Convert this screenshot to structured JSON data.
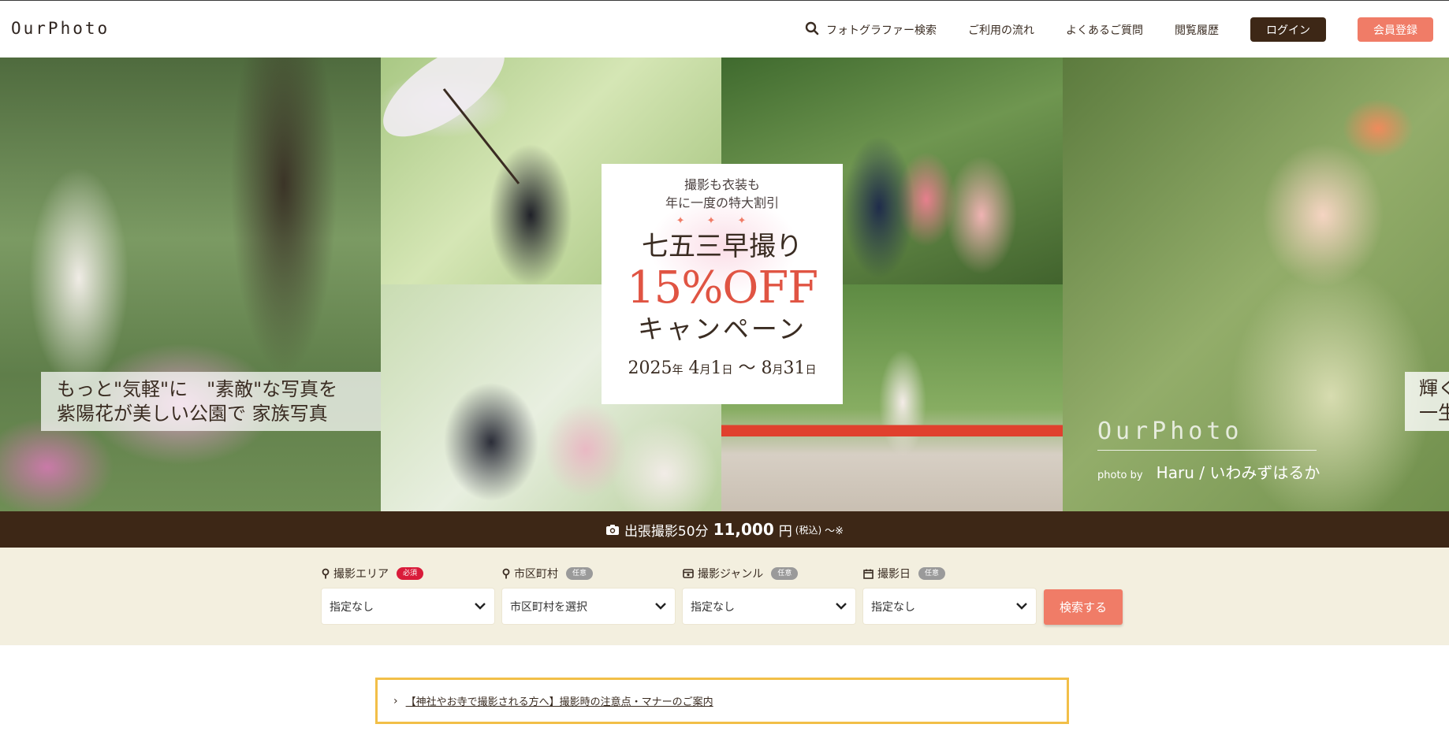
{
  "header": {
    "logo": "OurPhoto",
    "nav": [
      {
        "label": "フォトグラファー検索",
        "icon": "search-icon"
      },
      {
        "label": "ご利用の流れ"
      },
      {
        "label": "よくあるご質問"
      },
      {
        "label": "閲覧履歴"
      }
    ],
    "login_label": "ログイン",
    "register_label": "会員登録",
    "login_color": "#3d2716",
    "register_color": "#f07c67"
  },
  "hero": {
    "left_caption": {
      "line1": "もっと\"気軽\"に　\"素敵\"な写真を",
      "line2": "紫陽花が美しい公園で 家族写真"
    },
    "promo": {
      "sub1": "撮影も衣装も",
      "sub2": "年に一度の特大割引",
      "stars": "✦✦✦",
      "main": "七五三早撮り",
      "off": "15%OFF",
      "campaign": "キャンペーン",
      "date_year": "2025",
      "date_year_unit": "年",
      "date_start_month": "4",
      "date_month_unit": "月",
      "date_start_day": "1",
      "date_day_unit": "日",
      "date_sep": "～",
      "date_end_month": "8",
      "date_end_day": "31"
    },
    "brand_overlay": {
      "logo": "OurPhoto",
      "photo_by": "photo by",
      "photographer": "Haru / いわみずはるか"
    },
    "side_caption": {
      "line1": "輝く",
      "line2": "一生"
    }
  },
  "price_bar": {
    "icon": "camera-icon",
    "label": "出張撮影50分",
    "amount": "11,000",
    "unit": "円",
    "tax": "(税込)",
    "suffix": "～※",
    "bg_color": "#3d2716"
  },
  "search": {
    "fields": [
      {
        "label": "撮影エリア",
        "badge": "必須",
        "badge_type": "required",
        "icon": "map-pin-icon",
        "value": "指定なし"
      },
      {
        "label": "市区町村",
        "badge": "任意",
        "badge_type": "optional",
        "icon": "map-pin-icon",
        "value": "市区町村を選択"
      },
      {
        "label": "撮影ジャンル",
        "badge": "任意",
        "badge_type": "optional",
        "icon": "camera-genre-icon",
        "value": "指定なし"
      },
      {
        "label": "撮影日",
        "badge": "任意",
        "badge_type": "optional",
        "icon": "calendar-icon",
        "value": "指定なし"
      }
    ],
    "button_label": "検索する",
    "panel_color": "#f3efdf"
  },
  "notice": {
    "text": "【神社やお寺で撮影される方へ】撮影時の注意点・マナーのご案内",
    "border_color": "#f2bf48"
  }
}
